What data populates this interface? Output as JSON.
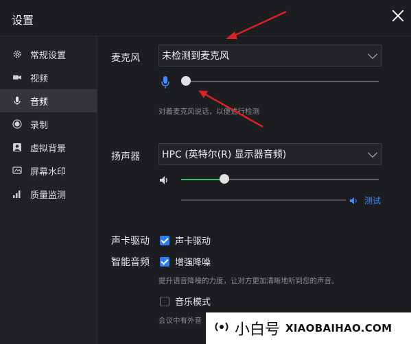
{
  "window": {
    "title": "设置"
  },
  "sidebar": {
    "items": [
      {
        "label": "常规设置",
        "icon": "gear-icon",
        "active": false
      },
      {
        "label": "视频",
        "icon": "camera-icon",
        "active": false
      },
      {
        "label": "音频",
        "icon": "microphone-icon",
        "active": true
      },
      {
        "label": "录制",
        "icon": "record-icon",
        "active": false
      },
      {
        "label": "虚拟背景",
        "icon": "person-icon",
        "active": false
      },
      {
        "label": "屏幕水印",
        "icon": "watermark-icon",
        "active": false
      },
      {
        "label": "质量监测",
        "icon": "signal-bars-icon",
        "active": false
      }
    ]
  },
  "microphone": {
    "label": "麦克风",
    "selected": "未检测到麦克风",
    "hint": "对着麦克风说话，以便进行检测",
    "level": 0
  },
  "speaker": {
    "label": "扬声器",
    "selected": "HPC (英特尔(R) 显示器音频)",
    "volume_percent": 22,
    "test_label": "测试"
  },
  "soundcard": {
    "section_label": "声卡驱动",
    "checkbox_label": "声卡驱动",
    "checked": true
  },
  "smart_audio": {
    "section_label": "智能音频",
    "noise_label": "增强降噪",
    "noise_checked": true,
    "noise_hint": "提升语音降噪的力度，让对方更加清晰地听到您的声音。",
    "music_label": "音乐模式",
    "music_checked": false,
    "music_hint": "会议中有外音"
  },
  "watermark": {
    "brand_zh": "小白号",
    "brand_en": "XIAOBAIHAO.COM"
  },
  "colors": {
    "accent": "#2f7df6",
    "level_green": "#2cc36b",
    "link": "#3d8bff",
    "annotation": "#d92222"
  }
}
